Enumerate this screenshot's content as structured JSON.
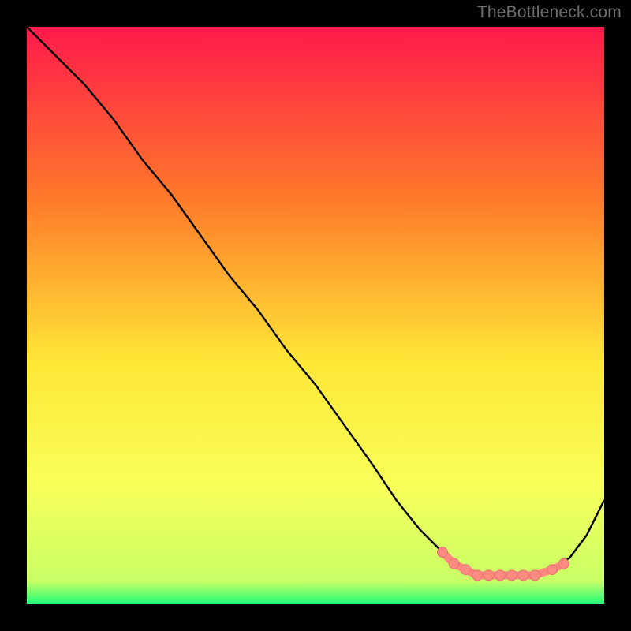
{
  "watermark": "TheBottleneck.com",
  "colors": {
    "frame_bg": "#000000",
    "gradient_top": "#ff1a4b",
    "gradient_mid1": "#ff7a2a",
    "gradient_mid2": "#ffe736",
    "gradient_mid3": "#f7ff5a",
    "gradient_bottom": "#20ff7a",
    "curve": "#000000",
    "marker_fill": "#ff8a80",
    "marker_stroke": "#e57373"
  },
  "chart_data": {
    "type": "line",
    "title": "",
    "xlabel": "",
    "ylabel": "",
    "xlim": [
      0,
      100
    ],
    "ylim": [
      0,
      100
    ],
    "series": [
      {
        "name": "bottleneck-curve",
        "x": [
          0,
          3,
          6,
          10,
          15,
          20,
          25,
          30,
          35,
          40,
          45,
          50,
          55,
          60,
          64,
          68,
          72,
          75,
          78,
          80,
          82,
          85,
          88,
          91,
          94,
          97,
          100
        ],
        "y": [
          100,
          97,
          94,
          90,
          84,
          77,
          71,
          64,
          57,
          51,
          44,
          38,
          31,
          24,
          18,
          13,
          9,
          6,
          5,
          5,
          5,
          5,
          5,
          6,
          8,
          12,
          18
        ]
      }
    ],
    "markers": {
      "name": "highlighted-points",
      "x": [
        72,
        74,
        76,
        78,
        80,
        82,
        84,
        86,
        88,
        91,
        93
      ],
      "y": [
        9,
        7,
        6,
        5,
        5,
        5,
        5,
        5,
        5,
        6,
        7
      ]
    },
    "gradient_stops": [
      {
        "offset": 0.0,
        "color": "#ff1a4b"
      },
      {
        "offset": 0.3,
        "color": "#ff7a2a"
      },
      {
        "offset": 0.58,
        "color": "#ffe736"
      },
      {
        "offset": 0.8,
        "color": "#f7ff5a"
      },
      {
        "offset": 0.96,
        "color": "#c8ff66"
      },
      {
        "offset": 1.0,
        "color": "#20ff7a"
      }
    ]
  }
}
